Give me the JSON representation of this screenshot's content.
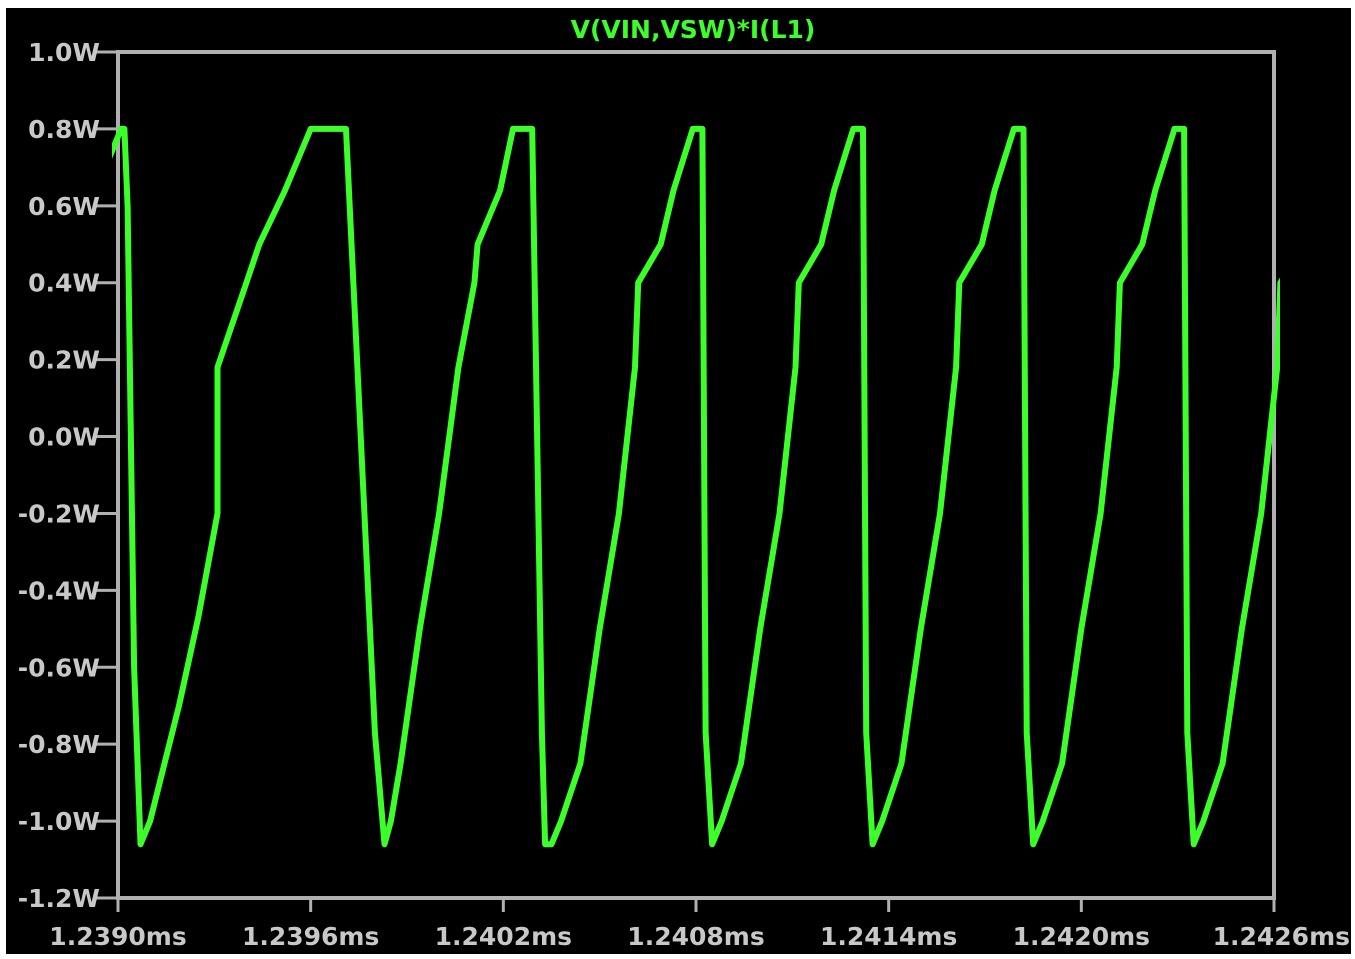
{
  "chart_data": {
    "type": "line",
    "title": "V(VIN,VSW)*I(L1)",
    "xlabel": "",
    "ylabel": "",
    "xlim": [
      1.239,
      1.2426
    ],
    "ylim": [
      -1.2,
      1.0
    ],
    "x_tick_labels": [
      "1.2390ms",
      "1.2396ms",
      "1.2402ms",
      "1.2408ms",
      "1.2414ms",
      "1.2420ms",
      "1.2426ms"
    ],
    "x_ticks": [
      1.239,
      1.2396,
      1.2402,
      1.2408,
      1.2414,
      1.242,
      1.2426
    ],
    "y_tick_labels": [
      "1.0W",
      "0.8W",
      "0.6W",
      "0.4W",
      "0.2W",
      "0.0W",
      "-0.2W",
      "-0.4W",
      "-0.6W",
      "-0.8W",
      "-1.0W",
      "-1.2W"
    ],
    "y_ticks": [
      1.0,
      0.8,
      0.6,
      0.4,
      0.2,
      0.0,
      -0.2,
      -0.4,
      -0.6,
      -0.8,
      -1.0,
      -1.2
    ],
    "grid": false,
    "series": [
      {
        "name": "V(VIN,VSW)*I(L1)",
        "color": "#3cff2a",
        "x": [
          1.23897,
          1.23899,
          1.23901,
          1.23902,
          1.23903,
          1.23905,
          1.23907,
          1.2391,
          1.23913,
          1.23919,
          1.23925,
          1.23931,
          1.23931,
          1.2394,
          1.23944,
          1.23952,
          1.2396,
          1.23971,
          1.2398,
          1.23983,
          1.23983,
          1.23985,
          1.23988,
          1.23994,
          1.24,
          1.24006,
          1.24011,
          1.24012,
          1.24019,
          1.24023,
          1.24029,
          1.24032,
          1.24033,
          1.24035,
          1.24038,
          1.24044,
          1.2405,
          1.24056,
          1.24061,
          1.24062,
          1.24069,
          1.24073,
          1.24079,
          1.24082,
          1.24083,
          1.24085,
          1.24088,
          1.24094,
          1.241,
          1.24106,
          1.24111,
          1.24112,
          1.24119,
          1.24123,
          1.24129,
          1.24132,
          1.24133,
          1.24135,
          1.24138,
          1.24144,
          1.2415,
          1.24156,
          1.24161,
          1.24162,
          1.24169,
          1.24173,
          1.24179,
          1.24182,
          1.24183,
          1.24185,
          1.24188,
          1.24194,
          1.242,
          1.24206,
          1.24211,
          1.24212,
          1.24219,
          1.24223,
          1.24229,
          1.24232,
          1.24233,
          1.24235,
          1.24238,
          1.24244,
          1.2425,
          1.24256,
          1.24261,
          1.24262,
          1.24269
        ],
        "y": [
          0.72,
          0.76,
          0.8,
          0.8,
          0.6,
          -0.6,
          -1.06,
          -1.0,
          -0.9,
          -0.7,
          -0.47,
          -0.2,
          0.18,
          0.4,
          0.5,
          0.64,
          0.8,
          0.8,
          -0.77,
          -1.06,
          -1.06,
          -1.0,
          -0.85,
          -0.5,
          -0.2,
          0.18,
          0.4,
          0.5,
          0.64,
          0.8,
          0.8,
          -0.77,
          -1.06,
          -1.06,
          -1.0,
          -0.85,
          -0.5,
          -0.2,
          0.18,
          0.4,
          0.5,
          0.64,
          0.8,
          0.8,
          -0.77,
          -1.06,
          -1.0,
          -0.85,
          -0.5,
          -0.2,
          0.18,
          0.4,
          0.5,
          0.64,
          0.8,
          0.8,
          -0.77,
          -1.06,
          -1.0,
          -0.85,
          -0.5,
          -0.2,
          0.18,
          0.4,
          0.5,
          0.64,
          0.8,
          0.8,
          -0.77,
          -1.06,
          -1.0,
          -0.85,
          -0.5,
          -0.2,
          0.18,
          0.4,
          0.5,
          0.64,
          0.8,
          0.8,
          -0.77,
          -1.06,
          -1.0,
          -0.85,
          -0.5,
          -0.2,
          0.18,
          0.4,
          0.5
        ]
      }
    ]
  }
}
